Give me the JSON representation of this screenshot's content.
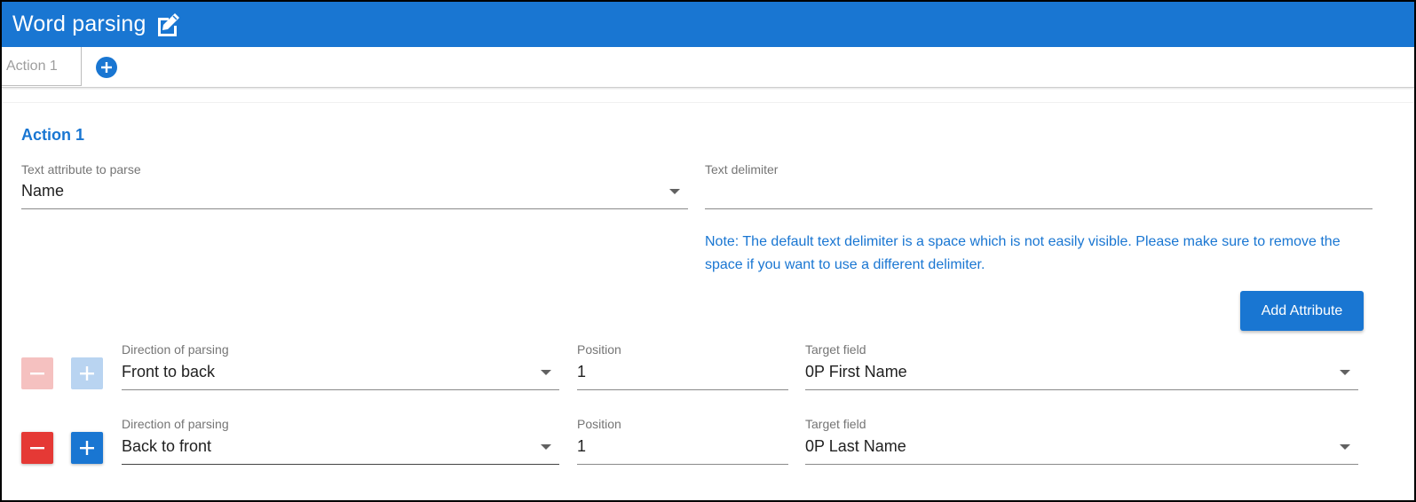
{
  "header": {
    "title": "Word parsing",
    "edit_icon": "edit-square-icon"
  },
  "tabs": {
    "items": [
      {
        "label": "Action 1"
      }
    ],
    "add_icon": "plus-circle-icon"
  },
  "action": {
    "title": "Action 1",
    "text_attribute": {
      "label": "Text attribute to parse",
      "value": "Name"
    },
    "text_delimiter": {
      "label": "Text delimiter",
      "value": " "
    },
    "note": "Note: The default text delimiter is a space which is not easily visible. Please make sure to remove the space if you want to use a different delimiter.",
    "add_attribute_label": "Add Attribute",
    "rows": [
      {
        "direction_label": "Direction of parsing",
        "direction_value": "Front to back",
        "position_label": "Position",
        "position_value": "1",
        "target_label": "Target field",
        "target_value": "0P First Name",
        "buttons_disabled": true
      },
      {
        "direction_label": "Direction of parsing",
        "direction_value": "Back to front",
        "position_label": "Position",
        "position_value": "1",
        "target_label": "Target field",
        "target_value": "0P Last Name",
        "buttons_disabled": false
      }
    ]
  },
  "colors": {
    "primary": "#1976d2",
    "danger": "#e53935"
  }
}
